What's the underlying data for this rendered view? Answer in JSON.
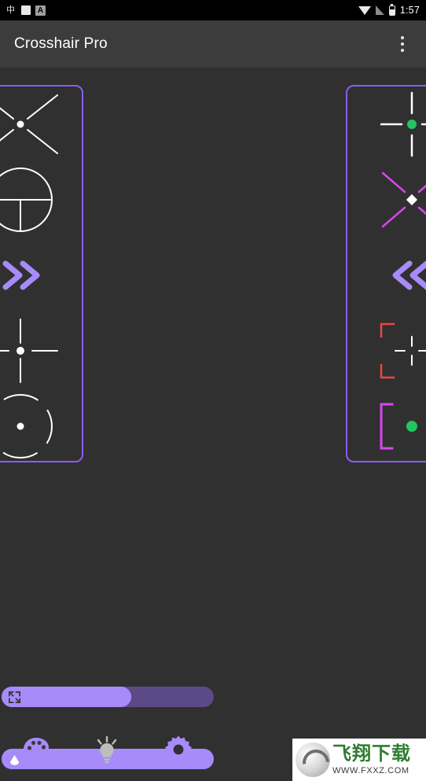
{
  "statusbar": {
    "left_icons": [
      "chinese-input-icon",
      "square-icon",
      "a-badge-icon"
    ],
    "input_glyph": "中",
    "a_glyph": "A",
    "right_icons": [
      "wifi-icon",
      "signal-icon",
      "battery-icon"
    ],
    "time": "1:57"
  },
  "appbar": {
    "title": "Crosshair Pro",
    "overflow_label": "more-options"
  },
  "crosshairs": {
    "left_column": [
      {
        "name": "x-cross-dot",
        "color": "#ffffff"
      },
      {
        "name": "circle-scope",
        "color": "#ffffff"
      },
      {
        "name": "double-chevron-right",
        "color": "#a78bfa"
      },
      {
        "name": "plus-dot",
        "color": "#ffffff"
      },
      {
        "name": "dashed-circle-dot",
        "color": "#ffffff"
      }
    ],
    "right_column": [
      {
        "name": "cross-green-dot",
        "color": "#ffffff",
        "accent": "#22c55e"
      },
      {
        "name": "x-diamond-magenta",
        "color": "#d946ef"
      },
      {
        "name": "double-chevron-left",
        "color": "#a78bfa"
      },
      {
        "name": "bracket-corners-cross",
        "color": "#ef4444"
      },
      {
        "name": "bracket-green-dot",
        "color": "#d946ef",
        "accent": "#22c55e"
      }
    ]
  },
  "controls": {
    "size_slider": {
      "name": "size-slider",
      "icon": "resize-icon",
      "value_percent": 62,
      "fill_color": "#a78bfa",
      "track_color": "#5b4a86"
    },
    "opacity_slider": {
      "name": "opacity-slider",
      "icon": "brightness-icon",
      "value_percent": 100,
      "fill_color": "#a78bfa"
    },
    "power_toggle": {
      "name": "overlay-toggle",
      "state": "off",
      "knob_color": "#e8420c",
      "track_color": "#5c3a22"
    }
  },
  "bottom_bar": {
    "items": [
      {
        "name": "palette-icon",
        "color": "#a78bfa"
      },
      {
        "name": "brightness-bulb-icon",
        "color": "#bdbdbd"
      },
      {
        "name": "settings-gear-icon",
        "color": "#a78bfa"
      }
    ]
  },
  "watermark": {
    "main_text": "飞翔下载",
    "sub_text": "WWW.FXXZ.COM"
  }
}
